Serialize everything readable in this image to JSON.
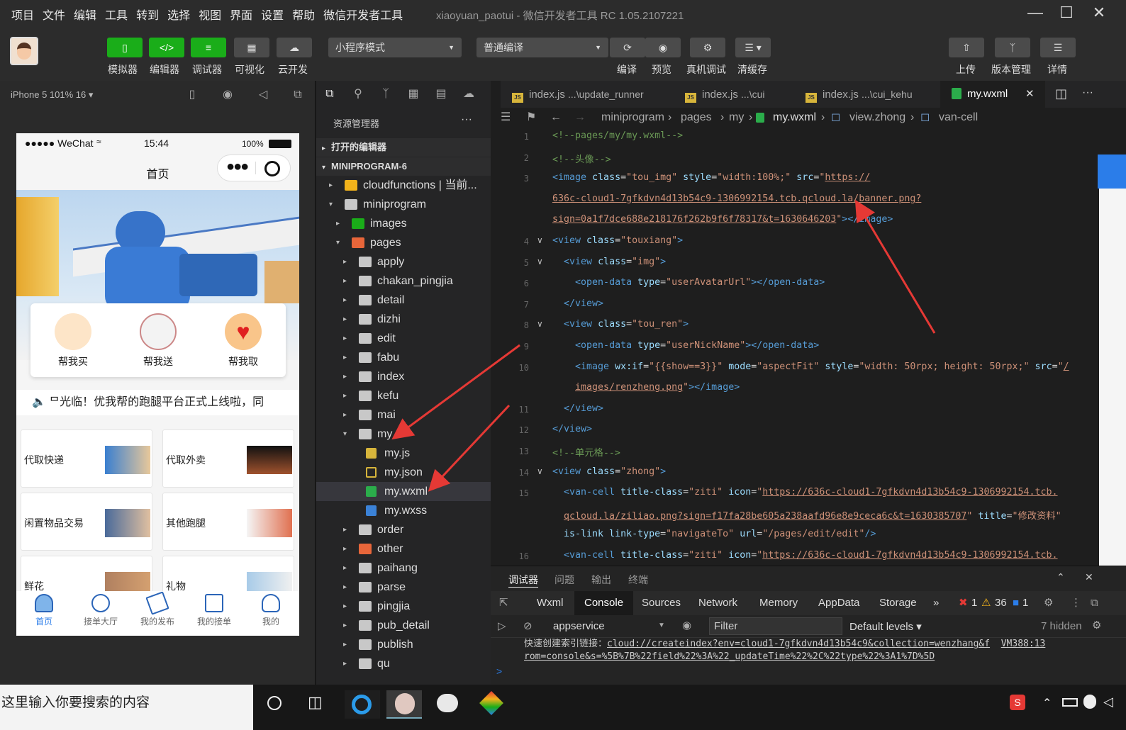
{
  "menu": [
    "项目",
    "文件",
    "编辑",
    "工具",
    "转到",
    "选择",
    "视图",
    "界面",
    "设置",
    "帮助",
    "微信开发者工具"
  ],
  "window_title": "xiaoyuan_paotui - 微信开发者工具 RC 1.05.2107221",
  "toolbar": {
    "simulator": "模拟器",
    "editor": "编辑器",
    "debugger": "调试器",
    "visual": "可视化",
    "cloud": "云开发",
    "mode": "小程序模式",
    "compile_mode": "普通编译",
    "compile": "编译",
    "preview": "预览",
    "real_debug": "真机调试",
    "clear_cache": "清缓存",
    "upload": "上传",
    "version": "版本管理",
    "details": "详情"
  },
  "simulator": {
    "device": "iPhone 5 101% 16 ▾",
    "status_carrier": "●●●●● WeChat",
    "status_time": "15:44",
    "status_battery": "100%",
    "nav_title": "首页",
    "services": [
      "帮我买",
      "帮我送",
      "帮我取"
    ],
    "notice": "🔈 ᄆ光临！优我帮的跑腿平台正式上线啦，同",
    "tiles": [
      "代取快递",
      "代取外卖",
      "闲置物品交易",
      "其他跑腿",
      "鲜花",
      "礼物"
    ],
    "tabs": [
      "首页",
      "接单大厅",
      "我的发布",
      "我的接单",
      "我的"
    ]
  },
  "explorer": {
    "title": "资源管理器",
    "open_editors": "打开的编辑器",
    "project": "MINIPROGRAM-6",
    "items": [
      {
        "name": "cloudfunctions | 当前...",
        "depth": 1,
        "arrow": "▸",
        "kind": "folder-cloud"
      },
      {
        "name": "miniprogram",
        "depth": 1,
        "arrow": "▾",
        "kind": "folder"
      },
      {
        "name": "images",
        "depth": 2,
        "arrow": "▸",
        "kind": "folder-img"
      },
      {
        "name": "pages",
        "depth": 2,
        "arrow": "▾",
        "kind": "folder-red"
      },
      {
        "name": "apply",
        "depth": 3,
        "arrow": "▸",
        "kind": "folder"
      },
      {
        "name": "chakan_pingjia",
        "depth": 3,
        "arrow": "▸",
        "kind": "folder"
      },
      {
        "name": "detail",
        "depth": 3,
        "arrow": "▸",
        "kind": "folder"
      },
      {
        "name": "dizhi",
        "depth": 3,
        "arrow": "▸",
        "kind": "folder"
      },
      {
        "name": "edit",
        "depth": 3,
        "arrow": "▸",
        "kind": "folder"
      },
      {
        "name": "fabu",
        "depth": 3,
        "arrow": "▸",
        "kind": "folder"
      },
      {
        "name": "index",
        "depth": 3,
        "arrow": "▸",
        "kind": "folder"
      },
      {
        "name": "kefu",
        "depth": 3,
        "arrow": "▸",
        "kind": "folder"
      },
      {
        "name": "mai",
        "depth": 3,
        "arrow": "▸",
        "kind": "folder"
      },
      {
        "name": "my",
        "depth": 3,
        "arrow": "▾",
        "kind": "folder"
      },
      {
        "name": "my.js",
        "depth": 4,
        "arrow": "",
        "kind": "js"
      },
      {
        "name": "my.json",
        "depth": 4,
        "arrow": "",
        "kind": "json"
      },
      {
        "name": "my.wxml",
        "depth": 4,
        "arrow": "",
        "kind": "wxml",
        "selected": true
      },
      {
        "name": "my.wxss",
        "depth": 4,
        "arrow": "",
        "kind": "wxss"
      },
      {
        "name": "order",
        "depth": 3,
        "arrow": "▸",
        "kind": "folder"
      },
      {
        "name": "other",
        "depth": 3,
        "arrow": "▸",
        "kind": "folder-red"
      },
      {
        "name": "paihang",
        "depth": 3,
        "arrow": "▸",
        "kind": "folder"
      },
      {
        "name": "parse",
        "depth": 3,
        "arrow": "▸",
        "kind": "folder"
      },
      {
        "name": "pingjia",
        "depth": 3,
        "arrow": "▸",
        "kind": "folder"
      },
      {
        "name": "pub_detail",
        "depth": 3,
        "arrow": "▸",
        "kind": "folder"
      },
      {
        "name": "publish",
        "depth": 3,
        "arrow": "▸",
        "kind": "folder"
      },
      {
        "name": "qu",
        "depth": 3,
        "arrow": "▸",
        "kind": "folder"
      }
    ]
  },
  "editor_tabs": [
    {
      "name": "index.js",
      "path": "...\\update_runner"
    },
    {
      "name": "index.js",
      "path": "...\\cui"
    },
    {
      "name": "index.js",
      "path": "...\\cui_kehu"
    },
    {
      "name": "my.wxml",
      "path": ""
    }
  ],
  "breadcrumb": [
    "miniprogram",
    "pages",
    "my",
    "my.wxml",
    "view.zhong",
    "van-cell"
  ],
  "code_lines": [
    {
      "n": "1",
      "parts": [
        [
          "cm",
          "<!--pages/my/my.wxml-->"
        ]
      ]
    },
    {
      "n": "2",
      "parts": [
        [
          "cm",
          "<!--头像-->"
        ]
      ]
    },
    {
      "n": "3",
      "parts": [
        [
          "tg",
          "<image "
        ],
        [
          "at",
          "class"
        ],
        [
          "pl",
          "="
        ],
        [
          "st",
          "\"tou_img\""
        ],
        [
          "at",
          " style"
        ],
        [
          "pl",
          "="
        ],
        [
          "st",
          "\"width:100%;\""
        ],
        [
          "at",
          " src"
        ],
        [
          "pl",
          "="
        ],
        [
          "st",
          "\""
        ],
        [
          "lk",
          "https://"
        ]
      ]
    },
    {
      "n": "",
      "parts": [
        [
          "lk",
          "636c-cloud1-7gfkdvn4d13b54c9-1306992154.tcb.qcloud.la/banner.png?"
        ]
      ]
    },
    {
      "n": "",
      "parts": [
        [
          "lk",
          "sign=0a1f7dce688e218176f262b9f6f78317&t=1630646203"
        ],
        [
          "st",
          "\""
        ],
        [
          "tg",
          ">"
        ],
        [
          "tg",
          "</image>"
        ]
      ]
    },
    {
      "n": "4",
      "parts": [
        [
          "tg",
          "<view "
        ],
        [
          "at",
          "class"
        ],
        [
          "pl",
          "="
        ],
        [
          "st",
          "\"touxiang\""
        ],
        [
          "tg",
          ">"
        ]
      ]
    },
    {
      "n": "5",
      "parts": [
        [
          "pl",
          "  "
        ],
        [
          "tg",
          "<view "
        ],
        [
          "at",
          "class"
        ],
        [
          "pl",
          "="
        ],
        [
          "st",
          "\"img\""
        ],
        [
          "tg",
          ">"
        ]
      ]
    },
    {
      "n": "6",
      "parts": [
        [
          "pl",
          "    "
        ],
        [
          "tg",
          "<open-data "
        ],
        [
          "at",
          "type"
        ],
        [
          "pl",
          "="
        ],
        [
          "st",
          "\"userAvatarUrl\""
        ],
        [
          "tg",
          "></open-data>"
        ]
      ]
    },
    {
      "n": "7",
      "parts": [
        [
          "pl",
          "  "
        ],
        [
          "tg",
          "</view>"
        ]
      ]
    },
    {
      "n": "8",
      "parts": [
        [
          "pl",
          "  "
        ],
        [
          "tg",
          "<view "
        ],
        [
          "at",
          "class"
        ],
        [
          "pl",
          "="
        ],
        [
          "st",
          "\"tou_ren\""
        ],
        [
          "tg",
          ">"
        ]
      ]
    },
    {
      "n": "9",
      "parts": [
        [
          "pl",
          "    "
        ],
        [
          "tg",
          "<open-data "
        ],
        [
          "at",
          "type"
        ],
        [
          "pl",
          "="
        ],
        [
          "st",
          "\"userNickName\""
        ],
        [
          "tg",
          "></open-data>"
        ]
      ]
    },
    {
      "n": "10",
      "parts": [
        [
          "pl",
          "    "
        ],
        [
          "tg",
          "<image "
        ],
        [
          "at",
          "wx:if"
        ],
        [
          "pl",
          "="
        ],
        [
          "st",
          "\"{{show==3}}\""
        ],
        [
          "at",
          " mode"
        ],
        [
          "pl",
          "="
        ],
        [
          "st",
          "\"aspectFit\""
        ],
        [
          "at",
          " style"
        ],
        [
          "pl",
          "="
        ],
        [
          "st",
          "\"width: 50rpx; height: 50rpx;\""
        ],
        [
          "at",
          " src"
        ],
        [
          "pl",
          "="
        ],
        [
          "st",
          "\""
        ],
        [
          "lk",
          "/"
        ]
      ]
    },
    {
      "n": "",
      "parts": [
        [
          "pl",
          "    "
        ],
        [
          "lk",
          "images/renzheng.png"
        ],
        [
          "st",
          "\""
        ],
        [
          "tg",
          "></image>"
        ]
      ]
    },
    {
      "n": "11",
      "parts": [
        [
          "pl",
          "  "
        ],
        [
          "tg",
          "</view>"
        ]
      ]
    },
    {
      "n": "12",
      "parts": [
        [
          "tg",
          "</view>"
        ]
      ]
    },
    {
      "n": "13",
      "parts": [
        [
          "cm",
          "<!--单元格-->"
        ]
      ]
    },
    {
      "n": "14",
      "parts": [
        [
          "tg",
          "<view "
        ],
        [
          "at",
          "class"
        ],
        [
          "pl",
          "="
        ],
        [
          "st",
          "\"zhong\""
        ],
        [
          "tg",
          ">"
        ]
      ]
    },
    {
      "n": "15",
      "parts": [
        [
          "pl",
          "  "
        ],
        [
          "tg",
          "<van-cell "
        ],
        [
          "at",
          "title-class"
        ],
        [
          "pl",
          "="
        ],
        [
          "st",
          "\"ziti\""
        ],
        [
          "at",
          " icon"
        ],
        [
          "pl",
          "="
        ],
        [
          "st",
          "\""
        ],
        [
          "lk",
          "https://636c-cloud1-7gfkdvn4d13b54c9-1306992154.tcb."
        ]
      ]
    },
    {
      "n": "",
      "parts": [
        [
          "pl",
          "  "
        ],
        [
          "lk",
          "qcloud.la/ziliao.png?sign=f17fa28be605a238aafd96e8e9ceca6c&t=1630385707"
        ],
        [
          "st",
          "\""
        ],
        [
          "at",
          " title"
        ],
        [
          "pl",
          "="
        ],
        [
          "st",
          "\"修改资料\""
        ]
      ]
    },
    {
      "n": "",
      "parts": [
        [
          "pl",
          "  "
        ],
        [
          "at",
          "is-link link-type"
        ],
        [
          "pl",
          "="
        ],
        [
          "st",
          "\"navigateTo\""
        ],
        [
          "at",
          " url"
        ],
        [
          "pl",
          "="
        ],
        [
          "st",
          "\"/pages/edit/edit\""
        ],
        [
          "tg",
          "/>"
        ]
      ]
    },
    {
      "n": "16",
      "parts": [
        [
          "pl",
          "  "
        ],
        [
          "tg",
          "<van-cell "
        ],
        [
          "at",
          "title-class"
        ],
        [
          "pl",
          "="
        ],
        [
          "st",
          "\"ziti\""
        ],
        [
          "at",
          " icon"
        ],
        [
          "pl",
          "="
        ],
        [
          "st",
          "\""
        ],
        [
          "lk",
          "https://636c-cloud1-7gfkdvn4d13b54c9-1306992154.tcb."
        ]
      ]
    }
  ],
  "devtools": {
    "panel_tabs": [
      "调试器",
      "问题",
      "输出",
      "终端"
    ],
    "tabs": [
      "Wxml",
      "Console",
      "Sources",
      "Network",
      "Memory",
      "AppData",
      "Storage"
    ],
    "more": "»",
    "errors": "1",
    "warnings": "36",
    "infos": "1",
    "context": "appservice",
    "filter_placeholder": "Filter",
    "levels": "Default levels ▾",
    "hidden": "7 hidden",
    "console_text": "快速创建索引链接：",
    "console_link_1": "cloud://createindex?env=cloud1-7gfkdvn4d13b54c9&collection=wenzhang&f",
    "console_link_2": "rom=console&s=%5B%7B%22field%22%3A%22_updateTime%22%2C%22type%22%3A1%7D%5D",
    "console_source": "VM388:13",
    "prompt": ">"
  },
  "taskbar": {
    "search": "这里输入你要搜索的内容"
  },
  "colors": {
    "accent_green": "#1aad19",
    "arrow_red": "#e53935",
    "link_blue": "#2b7de9"
  }
}
